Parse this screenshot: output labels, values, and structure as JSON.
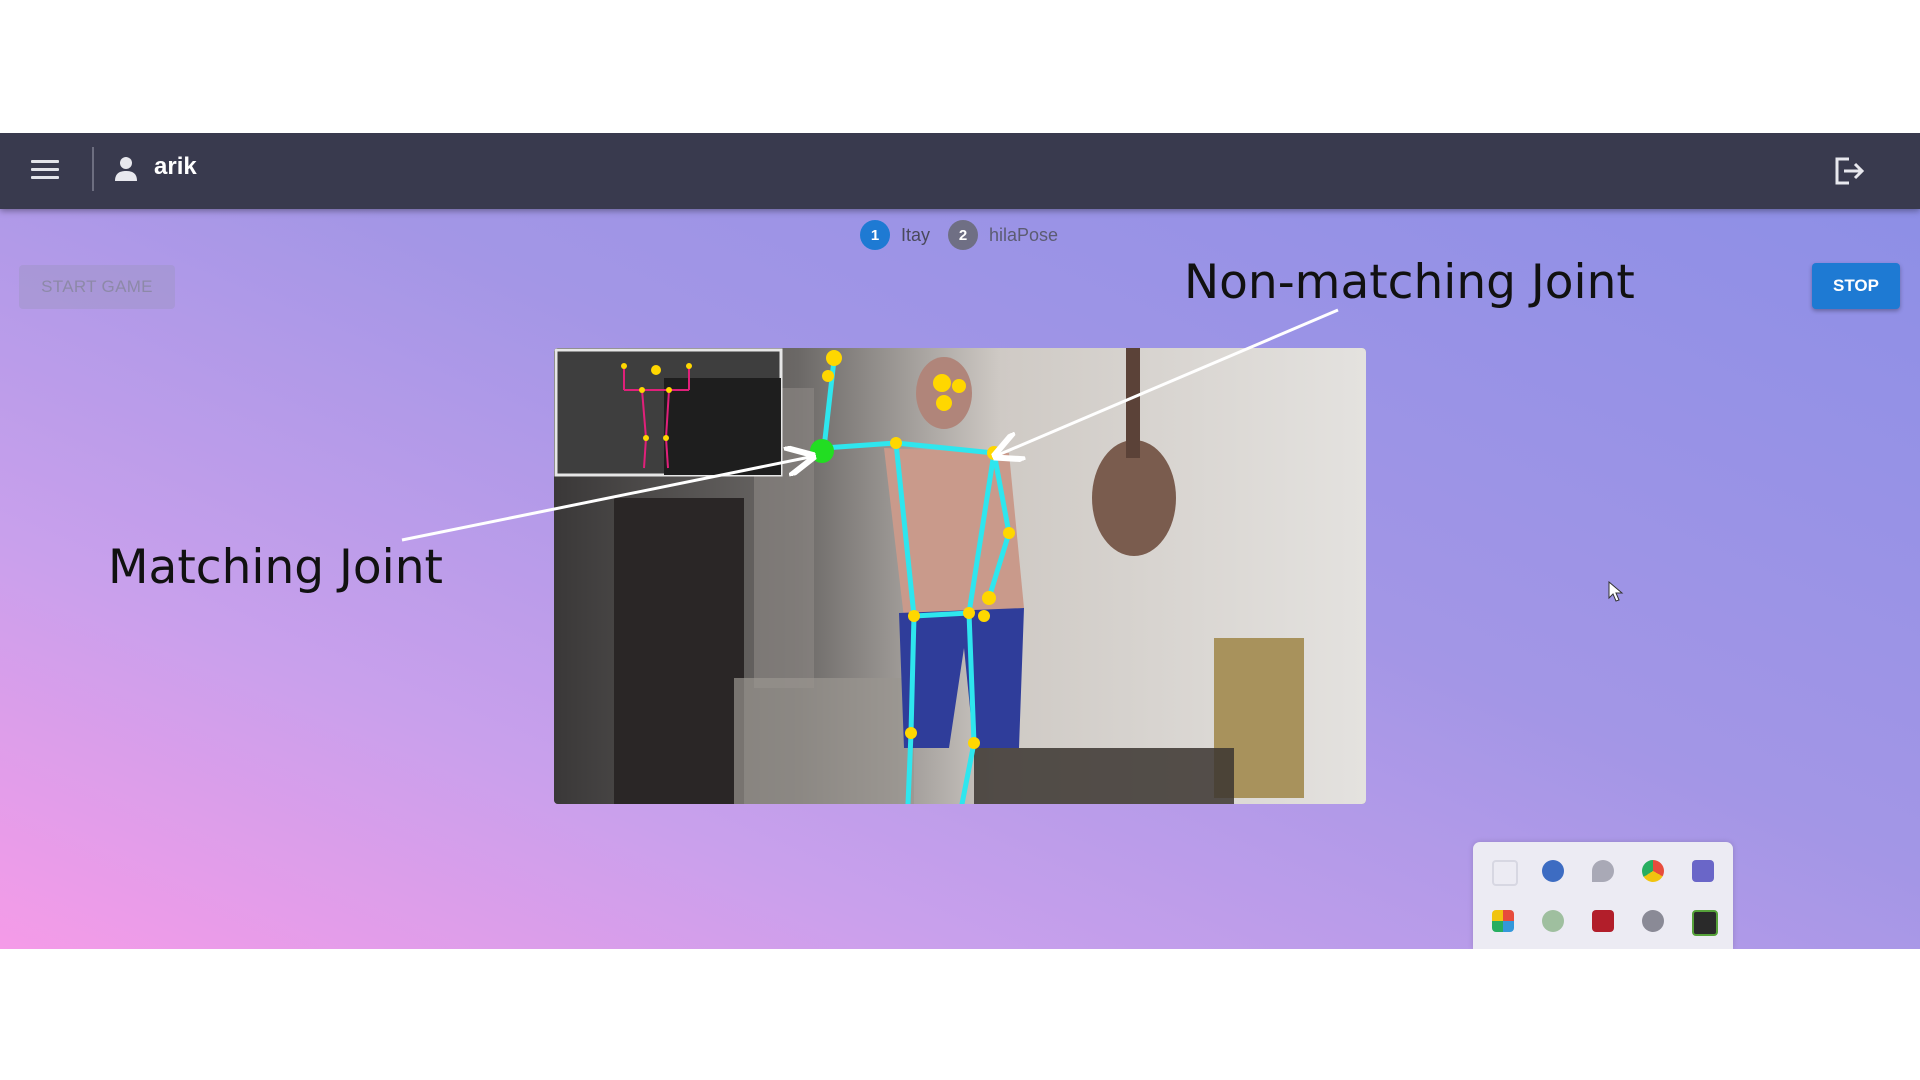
{
  "topbar": {
    "menu_icon": "hamburger-menu-icon",
    "user_icon": "person-icon",
    "username": "arik",
    "logout_icon": "logout-icon"
  },
  "stepper": {
    "steps": [
      {
        "number": "1",
        "label": "Itay",
        "state": "active"
      },
      {
        "number": "2",
        "label": "hilaPose",
        "state": "inactive"
      }
    ]
  },
  "controls": {
    "start_label": "START GAME",
    "stop_label": "STOP"
  },
  "annotations": {
    "matching": "Matching Joint",
    "non_matching": "Non-matching Joint"
  },
  "tray_icons": [
    "notion-icon",
    "security-shield-icon",
    "location-pin-icon",
    "chrome-icon",
    "teams-icon",
    "color-palette-icon",
    "check-shield-icon",
    "red-app-icon",
    "settings-gear-icon",
    "nvidia-icon"
  ],
  "colors": {
    "topbar": "#393a4e",
    "primary_button": "#1e7ad3",
    "skeleton_line": "#2ee6ee",
    "joint_default": "#ffd700",
    "joint_matching": "#22dd22"
  }
}
